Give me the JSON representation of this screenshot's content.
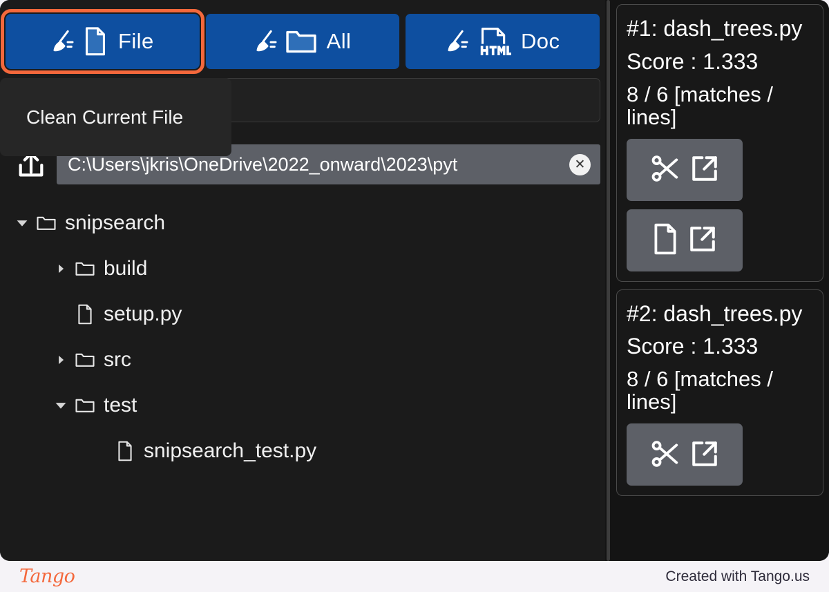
{
  "toolbar": {
    "tabs": [
      {
        "label": "File",
        "icon": "broom-file-icon",
        "selected": true
      },
      {
        "label": "All",
        "icon": "broom-folder-icon",
        "selected": false
      },
      {
        "label": "Doc",
        "icon": "broom-html-icon",
        "selected": false
      }
    ]
  },
  "tooltip": {
    "text": "Clean Current File"
  },
  "search": {
    "value": "",
    "placeholder": ""
  },
  "path_bar": {
    "up_icon": "arrow-up-icon",
    "path": "C:\\Users\\jkris\\OneDrive\\2022_onward\\2023\\pyt",
    "clear_label": "✕"
  },
  "file_tree": [
    {
      "name": "snipsearch",
      "type": "folder",
      "depth": 0,
      "expanded": true,
      "caret": "▼"
    },
    {
      "name": "build",
      "type": "folder",
      "depth": 1,
      "expanded": false,
      "caret": "▶"
    },
    {
      "name": "setup.py",
      "type": "file",
      "depth": 1,
      "expanded": null,
      "caret": ""
    },
    {
      "name": "src",
      "type": "folder",
      "depth": 1,
      "expanded": false,
      "caret": "▶"
    },
    {
      "name": "test",
      "type": "folder",
      "depth": 1,
      "expanded": true,
      "caret": "▼"
    },
    {
      "name": "snipsearch_test.py",
      "type": "file",
      "depth": 2,
      "expanded": null,
      "caret": ""
    }
  ],
  "results": [
    {
      "title": "#1: dash_trees.py",
      "score": "Score : 1.333",
      "matches": "8 / 6 [matches / lines]",
      "buttons": [
        {
          "icons": [
            "scissors-icon",
            "external-link-icon"
          ],
          "name": "open-snippet-button"
        },
        {
          "icons": [
            "file-icon",
            "external-link-icon"
          ],
          "name": "open-file-button"
        }
      ]
    },
    {
      "title": "#2: dash_trees.py",
      "score": "Score : 1.333",
      "matches": "8 / 6 [matches / lines]",
      "buttons": [
        {
          "icons": [
            "scissors-icon",
            "external-link-icon"
          ],
          "name": "open-snippet-button"
        }
      ]
    }
  ],
  "footer": {
    "logo_text": "Tango",
    "credit": "Created with Tango.us"
  },
  "colors": {
    "tab_blue": "#0e4fa0",
    "highlight_orange": "#f4683c",
    "app_background": "#1b1b1b",
    "sidebar_background": "#141414",
    "button_gray": "#5d6067",
    "footer_background": "#f5f3f7"
  }
}
